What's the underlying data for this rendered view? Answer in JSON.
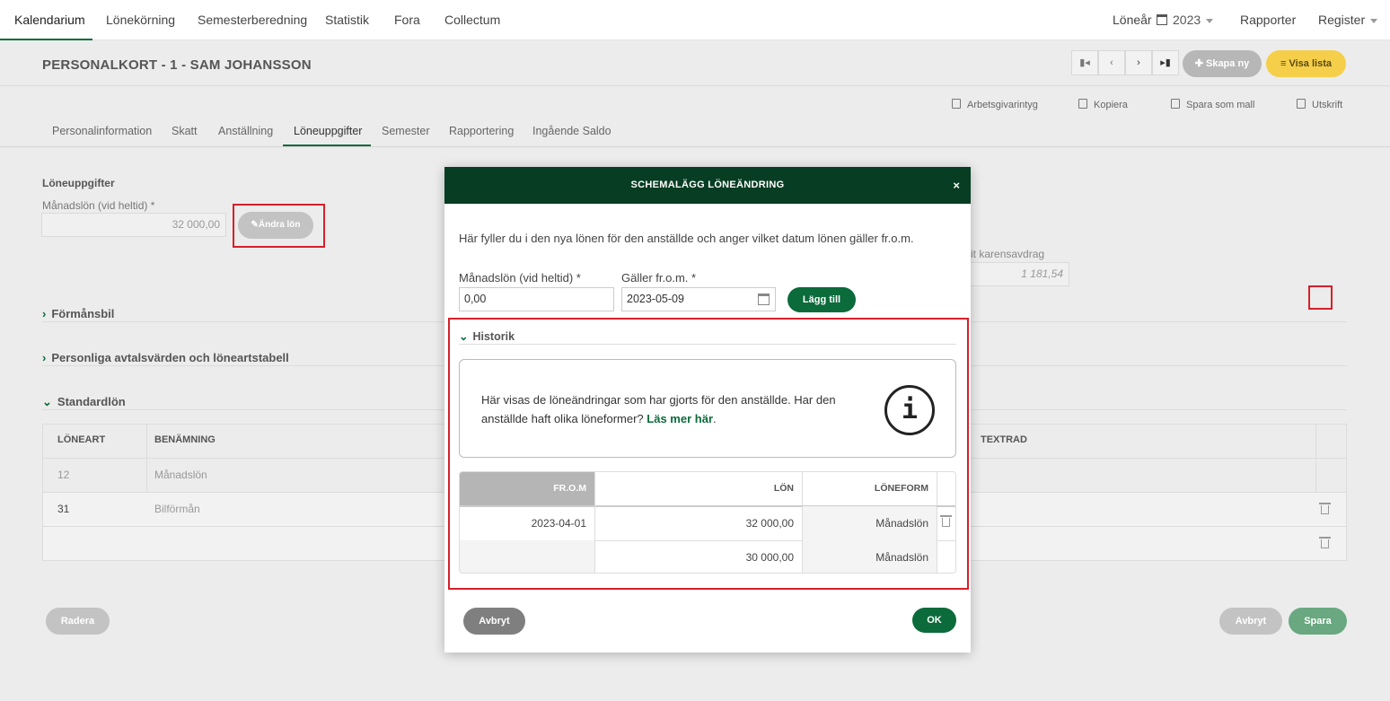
{
  "nav": {
    "items": [
      "Kalendarium",
      "Lönekörning",
      "Semesterberedning",
      "Statistik",
      "Fora",
      "Collectum"
    ],
    "loneyear_label": "Löneår",
    "year": "2023",
    "reports": "Rapporter",
    "register": "Register"
  },
  "header": {
    "title": "PERSONALKORT - 1 - SAM JOHANSSON",
    "create_new": "Skapa ny",
    "show_list": "Visa lista"
  },
  "actions": [
    "Arbetsgivarintyg",
    "Kopiera",
    "Spara som mall",
    "Utskrift"
  ],
  "tabs": [
    "Personalinformation",
    "Skatt",
    "Anställning",
    "Löneuppgifter",
    "Semester",
    "Rapportering",
    "Ingående Saldo"
  ],
  "salary": {
    "section_label": "Löneuppgifter",
    "monthly_label": "Månadslön (vid heltid) *",
    "monthly_value": "32 000,00",
    "change_button": "Ändra lön",
    "karens_label": "karensavdrag",
    "karens_value": "1 181,54"
  },
  "sections": [
    "Förmånsbil",
    "Personliga avtalsvärden och löneartstabell",
    "Standardlön"
  ],
  "std_table": {
    "headers": [
      "LÖNEART",
      "BENÄMNING",
      "TEXTRAD"
    ],
    "rows": [
      {
        "art": "12",
        "name": "Månadslön"
      },
      {
        "art": "31",
        "name": "Bilförmån"
      }
    ]
  },
  "footer": {
    "delete": "Radera",
    "cancel": "Avbryt",
    "save": "Spara"
  },
  "modal": {
    "title": "SCHEMALÄGG LÖNEÄNDRING",
    "close": "×",
    "description": "Här fyller du i den nya lönen för den anställde och anger vilket datum lönen gäller fr.o.m.",
    "monthly_label": "Månadslön (vid heltid) *",
    "monthly_value": "0,00",
    "valid_from_label": "Gäller fr.o.m. *",
    "valid_from_value": "2023-05-09",
    "add_button": "Lägg till",
    "history_title": "Historik",
    "info_text": "Här visas de löneändringar som har gjorts för den anställde. Har den anställde haft olika löneformer?",
    "info_link": "Läs mer här",
    "info_icon": "i",
    "history_headers": [
      "FR.O.M",
      "LÖN",
      "LÖNEFORM"
    ],
    "history_rows": [
      {
        "from": "2023-04-01",
        "salary": "32 000,00",
        "form": "Månadslön"
      },
      {
        "from": "",
        "salary": "30 000,00",
        "form": "Månadslön"
      }
    ],
    "cancel": "Avbryt",
    "ok": "OK"
  }
}
